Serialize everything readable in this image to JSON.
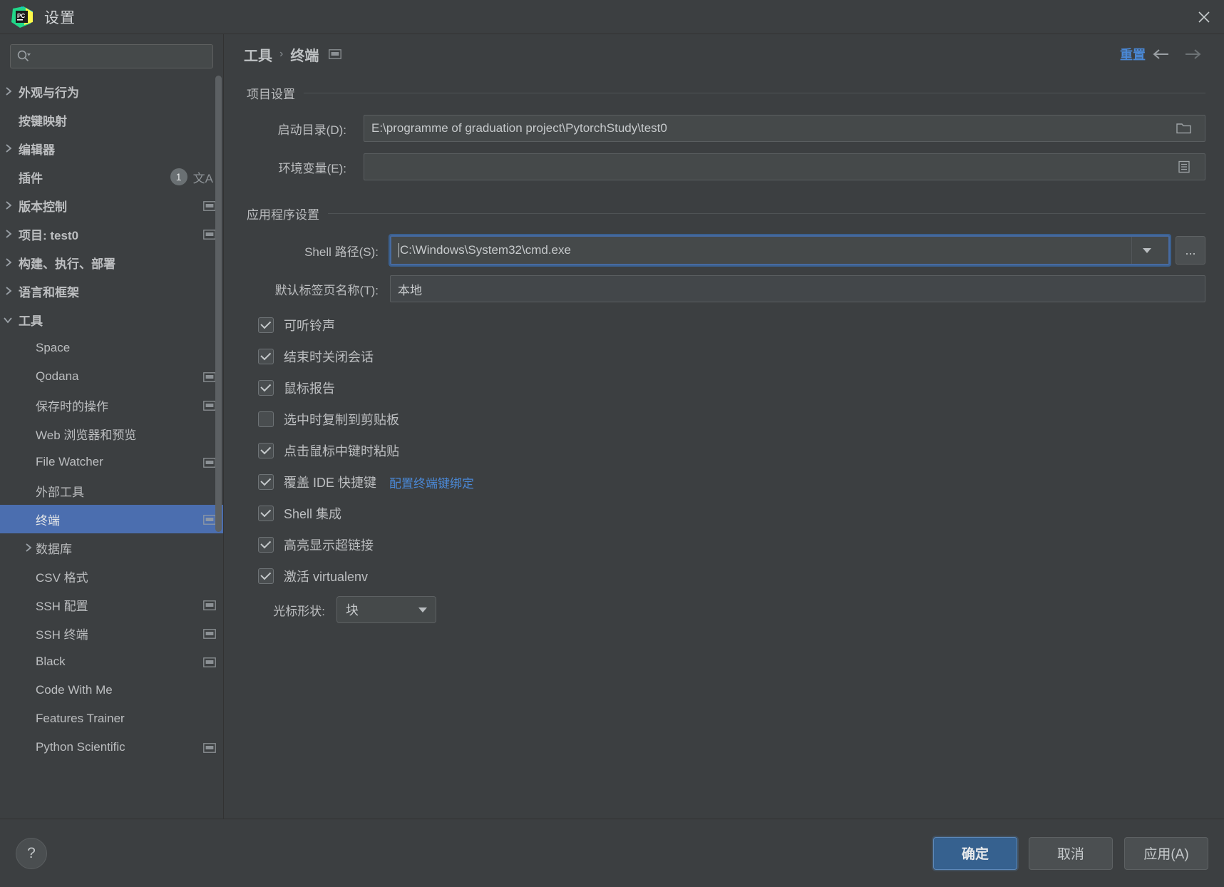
{
  "window": {
    "title": "设置",
    "logo_icon": "pycharm-logo-icon",
    "close_icon": "close-icon"
  },
  "search": {
    "placeholder": "",
    "value": "",
    "icon": "search-icon"
  },
  "sidebar": {
    "items": [
      {
        "label": "外观与行为",
        "depth": 0,
        "expandable": true,
        "expanded": false,
        "selected": false,
        "scope_icon": false,
        "badge": null
      },
      {
        "label": "按键映射",
        "depth": 0,
        "expandable": false,
        "expanded": false,
        "selected": false,
        "scope_icon": false,
        "badge": null
      },
      {
        "label": "编辑器",
        "depth": 0,
        "expandable": true,
        "expanded": false,
        "selected": false,
        "scope_icon": false,
        "badge": null
      },
      {
        "label": "插件",
        "depth": 0,
        "expandable": false,
        "expanded": false,
        "selected": false,
        "scope_icon": false,
        "badge": "1",
        "translate_icon": true
      },
      {
        "label": "版本控制",
        "depth": 0,
        "expandable": true,
        "expanded": false,
        "selected": false,
        "scope_icon": true,
        "badge": null
      },
      {
        "label": "项目: test0",
        "depth": 0,
        "expandable": true,
        "expanded": false,
        "selected": false,
        "scope_icon": true,
        "badge": null
      },
      {
        "label": "构建、执行、部署",
        "depth": 0,
        "expandable": true,
        "expanded": false,
        "selected": false,
        "scope_icon": false,
        "badge": null
      },
      {
        "label": "语言和框架",
        "depth": 0,
        "expandable": true,
        "expanded": false,
        "selected": false,
        "scope_icon": false,
        "badge": null
      },
      {
        "label": "工具",
        "depth": 0,
        "expandable": true,
        "expanded": true,
        "selected": false,
        "scope_icon": false,
        "badge": null
      },
      {
        "label": "Space",
        "depth": 1,
        "expandable": false,
        "expanded": false,
        "selected": false,
        "scope_icon": false,
        "badge": null
      },
      {
        "label": "Qodana",
        "depth": 1,
        "expandable": false,
        "expanded": false,
        "selected": false,
        "scope_icon": true,
        "badge": null
      },
      {
        "label": "保存时的操作",
        "depth": 1,
        "expandable": false,
        "expanded": false,
        "selected": false,
        "scope_icon": true,
        "badge": null
      },
      {
        "label": "Web 浏览器和预览",
        "depth": 1,
        "expandable": false,
        "expanded": false,
        "selected": false,
        "scope_icon": false,
        "badge": null
      },
      {
        "label": "File Watcher",
        "depth": 1,
        "expandable": false,
        "expanded": false,
        "selected": false,
        "scope_icon": true,
        "badge": null
      },
      {
        "label": "外部工具",
        "depth": 1,
        "expandable": false,
        "expanded": false,
        "selected": false,
        "scope_icon": false,
        "badge": null
      },
      {
        "label": "终端",
        "depth": 1,
        "expandable": false,
        "expanded": false,
        "selected": true,
        "scope_icon": true,
        "badge": null
      },
      {
        "label": "数据库",
        "depth": 1,
        "expandable": true,
        "expanded": false,
        "selected": false,
        "scope_icon": false,
        "badge": null
      },
      {
        "label": "CSV 格式",
        "depth": 1,
        "expandable": false,
        "expanded": false,
        "selected": false,
        "scope_icon": false,
        "badge": null
      },
      {
        "label": "SSH 配置",
        "depth": 1,
        "expandable": false,
        "expanded": false,
        "selected": false,
        "scope_icon": true,
        "badge": null
      },
      {
        "label": "SSH 终端",
        "depth": 1,
        "expandable": false,
        "expanded": false,
        "selected": false,
        "scope_icon": true,
        "badge": null
      },
      {
        "label": "Black",
        "depth": 1,
        "expandable": false,
        "expanded": false,
        "selected": false,
        "scope_icon": true,
        "badge": null
      },
      {
        "label": "Code With Me",
        "depth": 1,
        "expandable": false,
        "expanded": false,
        "selected": false,
        "scope_icon": false,
        "badge": null
      },
      {
        "label": "Features Trainer",
        "depth": 1,
        "expandable": false,
        "expanded": false,
        "selected": false,
        "scope_icon": false,
        "badge": null
      },
      {
        "label": "Python Scientific",
        "depth": 1,
        "expandable": false,
        "expanded": false,
        "selected": false,
        "scope_icon": true,
        "badge": null
      }
    ]
  },
  "header": {
    "breadcrumb_parent": "工具",
    "breadcrumb_sep": "›",
    "breadcrumb_current": "终端",
    "scope_icon": "project-scope-icon",
    "reset_label": "重置",
    "back_icon": "arrow-left-icon",
    "forward_icon": "arrow-right-icon"
  },
  "project_settings": {
    "group_title": "项目设置",
    "start_dir": {
      "label": "启动目录(D):",
      "mnemonic": "D",
      "value": "E:\\programme of graduation project\\PytorchStudy\\test0",
      "browse_icon": "folder-icon"
    },
    "env_vars": {
      "label": "环境变量(E):",
      "mnemonic": "E",
      "value": "",
      "browse_icon": "list-edit-icon"
    }
  },
  "application_settings": {
    "group_title": "应用程序设置",
    "shell_path": {
      "label": "Shell 路径(S):",
      "mnemonic": "S",
      "value": "C:\\Windows\\System32\\cmd.exe",
      "dropdown_icon": "chevron-down-icon",
      "ellipsis_label": "...",
      "focused": true
    },
    "tab_name": {
      "label": "默认标签页名称(T):",
      "mnemonic": "T",
      "value": "本地"
    },
    "checkboxes": [
      {
        "label": "可听铃声",
        "checked": true,
        "link": null
      },
      {
        "label": "结束时关闭会话",
        "checked": true,
        "link": null
      },
      {
        "label": "鼠标报告",
        "checked": true,
        "link": null
      },
      {
        "label": "选中时复制到剪贴板",
        "checked": false,
        "link": null
      },
      {
        "label": "点击鼠标中键时粘贴",
        "checked": true,
        "link": null
      },
      {
        "label": "覆盖 IDE 快捷键",
        "checked": true,
        "link": "配置终端键绑定"
      },
      {
        "label": "Shell 集成",
        "checked": true,
        "link": null
      },
      {
        "label": "高亮显示超链接",
        "checked": true,
        "link": null
      },
      {
        "label": "激活 virtualenv",
        "checked": true,
        "link": null
      }
    ],
    "cursor_shape": {
      "label": "光标形状:",
      "value": "块",
      "arrow_icon": "chevron-down-icon"
    }
  },
  "footer": {
    "help_label": "?",
    "ok_label": "确定",
    "cancel_label": "取消",
    "apply_label": "应用(A)",
    "apply_mnemonic": "A"
  },
  "colors": {
    "accent_blue": "#4a88d6",
    "selection_blue": "#4b6eaf",
    "primary_button": "#36618f",
    "background": "#3c3f41",
    "field_background": "#45494a"
  }
}
